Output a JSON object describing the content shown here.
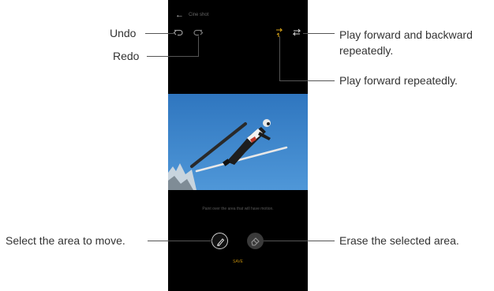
{
  "screen": {
    "title": "Cine shot",
    "instruction": "Paint over the area that will have motion.",
    "save_label": "SAVE"
  },
  "icons": {
    "back": "back-arrow-icon",
    "undo": "undo-icon",
    "redo": "redo-icon",
    "play_forward": "play-forward-icon",
    "play_bounce": "play-forward-backward-icon",
    "brush": "brush-icon",
    "eraser": "eraser-icon"
  },
  "photo": {
    "description": "ski jumper in flight against blue sky",
    "sky_color": "#3a82c8"
  },
  "callouts": {
    "undo": "Undo",
    "redo": "Redo",
    "bounce": "Play forward and backward repeatedly.",
    "forward": "Play forward repeatedly.",
    "select": "Select the area to move.",
    "erase": "Erase the selected area."
  },
  "colors": {
    "accent": "#d4a017",
    "phone_bg": "#000000",
    "callout_text": "#333333"
  }
}
